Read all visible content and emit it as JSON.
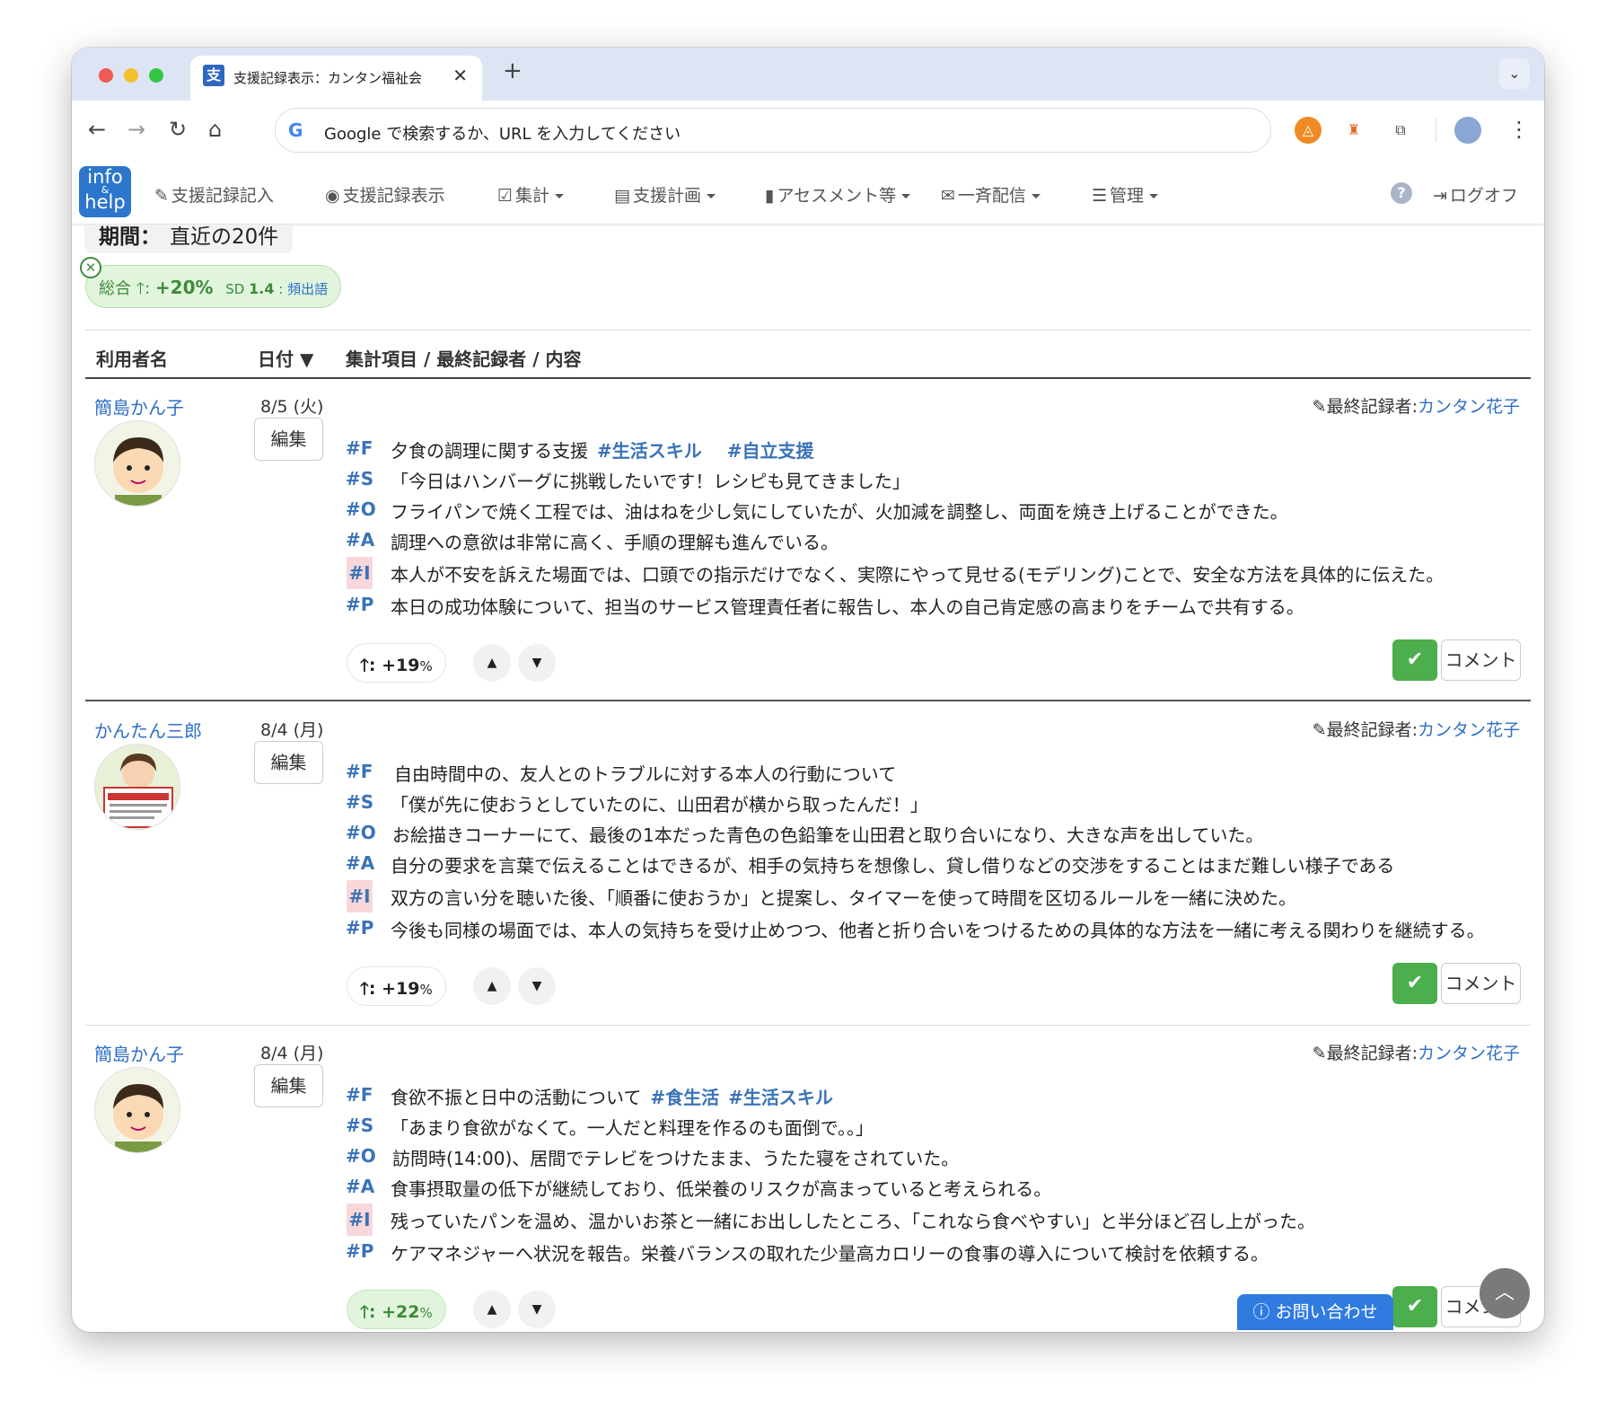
{
  "browser": {
    "tab_title": "支援記録表示：カンタン福祉会",
    "tab_favicon": "支",
    "omnibox_placeholder": "Google で検索するか、URL を入力してください"
  },
  "nav": {
    "logo_line1": "info",
    "logo_line2": "&",
    "logo_line3": "help",
    "items": [
      "支援記録記入",
      "支援記録表示",
      "集計",
      "支援計画",
      "アセスメント等",
      "一斉配信",
      "管理"
    ],
    "logoff": "ログオフ"
  },
  "filter": {
    "period_label": "期間：",
    "period_value": "直近の20件",
    "summary_label": "総合",
    "summary_trend": "+20%",
    "summary_sd_label": "SD",
    "summary_sd_value": "1.4",
    "summary_words": "頻出語"
  },
  "table": {
    "headers": [
      "利用者名",
      "日付 ▼",
      "集計項目 / 最終記録者 / 内容"
    ]
  },
  "last_recorder_label": "最終記録者:",
  "edit_label": "編集",
  "comment_label": "コメント",
  "records": [
    {
      "user": "簡島かん子",
      "date": "8/5 (火)",
      "recorder": "カンタン花子",
      "F": "夕食の調理に関する支援",
      "F_tags": [
        "#生活スキル",
        "#自立支援"
      ],
      "S": "「今日はハンバーグに挑戦したいです！レシピも見てきました」",
      "O": "フライパンで焼く工程では、油はねを少し気にしていたが、火加減を調整し、両面を焼き上げることができた。",
      "A": "調理への意欲は非常に高く、手順の理解も進んでいる。",
      "I": "本人が不安を訴えた場面では、口頭での指示だけでなく、実際にやって見せる(モデリング)ことで、安全な方法を具体的に伝えた。",
      "P": "本日の成功体験について、担当のサービス管理責任者に報告し、本人の自己肯定感の高まりをチームで共有する。",
      "trend": "+19",
      "trend_unit": "%"
    },
    {
      "user": "かんたん三郎",
      "date": "8/4 (月)",
      "recorder": "カンタン花子",
      "F": "自由時間中の、友人とのトラブルに対する本人の行動について",
      "F_tags": [],
      "S": "「僕が先に使おうとしていたのに、山田君が横から取ったんだ！」",
      "O": "お絵描きコーナーにて、最後の1本だった青色の色鉛筆を山田君と取り合いになり、大きな声を出していた。",
      "A": "自分の要求を言葉で伝えることはできるが、相手の気持ちを想像し、貸し借りなどの交渉をすることはまだ難しい様子である",
      "I": "双方の言い分を聴いた後、「順番に使おうか」と提案し、タイマーを使って時間を区切るルールを一緒に決めた。",
      "P": "今後も同様の場面では、本人の気持ちを受け止めつつ、他者と折り合いをつけるための具体的な方法を一緒に考える関わりを継続する。",
      "trend": "+19",
      "trend_unit": "%"
    },
    {
      "user": "簡島かん子",
      "date": "8/4 (月)",
      "recorder": "カンタン花子",
      "F": "食欲不振と日中の活動について",
      "F_tags": [
        "#食生活",
        "#生活スキル"
      ],
      "S": "「あまり食欲がなくて。一人だと料理を作るのも面倒で。。」",
      "O": "訪問時(14:00)、居間でテレビをつけたまま、うたた寝をされていた。",
      "A": "食事摂取量の低下が継続しており、低栄養のリスクが高まっていると考えられる。",
      "I": "残っていたパンを温め、温かいお茶と一緒にお出ししたところ、「これなら食べやすい」と半分ほど召し上がった。",
      "P": "ケアマネジャーへ状況を報告。栄養バランスの取れた少量高カロリーの食事の導入について検討を依頼する。",
      "trend": "+22",
      "trend_unit": "%"
    }
  ],
  "contact_label": "お問い合わせ"
}
